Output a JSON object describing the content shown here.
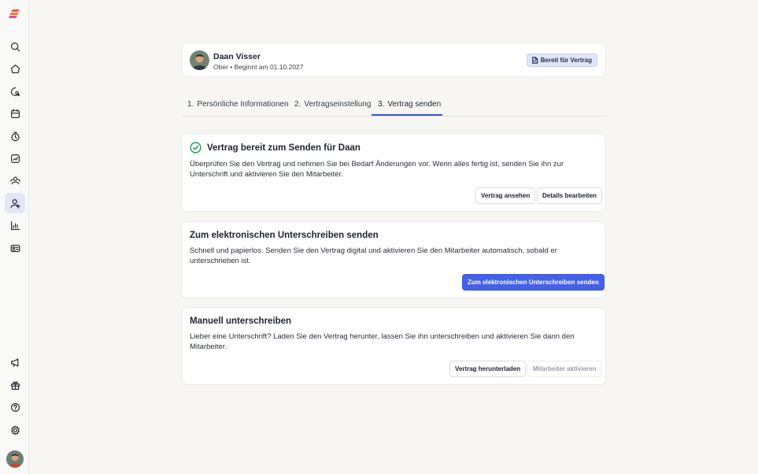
{
  "employee": {
    "name": "Daan Visser",
    "subtitle": "Ober • Beginnt am 01.10.2027",
    "status_badge": "Bereit für Vertrag"
  },
  "tabs": [
    {
      "num": "1.",
      "label": "Persönliche Informationen"
    },
    {
      "num": "2.",
      "label": "Vertragseinstellung"
    },
    {
      "num": "3.",
      "label": "Vertrag senden"
    }
  ],
  "ready_card": {
    "title": "Vertrag bereit zum Senden für Daan",
    "text": "Überprüfen Sie den Vertrag und nehmen Sie bei Bedarf Änderungen vor. Wenn alles fertig ist, senden Sie ihn zur Unterschrift und aktivieren Sie den Mitarbeiter.",
    "view_button": "Vertrag ansehen",
    "edit_button": "Details bearbeiten"
  },
  "esign_card": {
    "title": "Zum elektronischen Unterschreiben senden",
    "text": "Schnell und papierlos. Senden Sie den Vertrag digital und aktivieren Sie den Mitarbeiter automatisch, sobald er unterschrieben ist.",
    "send_button": "Zum elektronischen Unterschreiben senden"
  },
  "manual_card": {
    "title": "Manuell unterschreiben",
    "text": "Lieber eine Unterschrift? Laden Sie den Vertrag herunter, lassen Sie ihn unterschreiben und aktivieren Sie dann den Mitarbeiter.",
    "download_button": "Vertrag herunterladen",
    "activate_button": "Mitarbeiter aktivieren"
  },
  "sidebar": {
    "icons": [
      "search-icon",
      "home-icon",
      "chat-search-icon",
      "calendar-icon",
      "clock-icon",
      "approve-icon",
      "team-icon",
      "add-user-icon",
      "chart-icon",
      "id-card-icon",
      "megaphone-icon",
      "gift-icon",
      "help-icon",
      "settings-icon"
    ],
    "active": "add-user-icon"
  },
  "colors": {
    "accent": "#4561e8",
    "success": "#1f9d55",
    "background": "#f7f6f2"
  }
}
